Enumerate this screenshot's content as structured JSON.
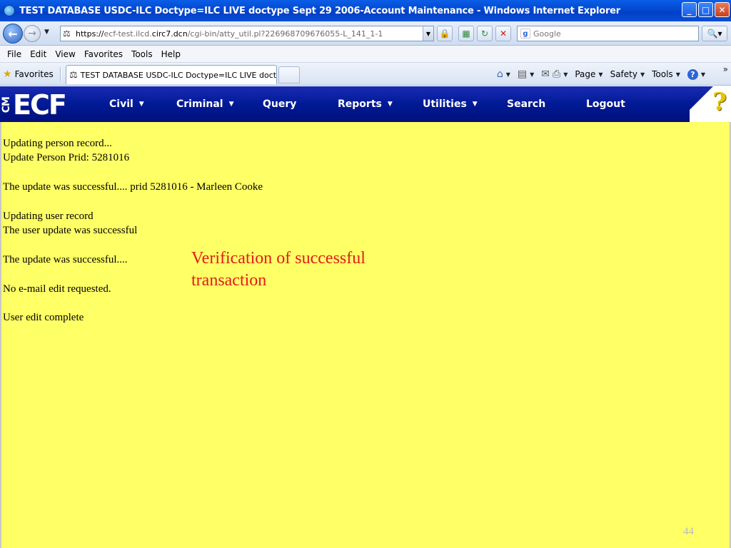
{
  "window": {
    "title": "TEST DATABASE USDC-ILC Doctype=ILC LIVE doctype Sept 29 2006-Account Maintenance - Windows Internet Explorer",
    "buttons": {
      "minimize": "_",
      "maximize": "□",
      "close": "✕"
    }
  },
  "address_bar": {
    "url_prefix": "https://",
    "url_host_dim": "ecf-test.ilcd.",
    "url_host": "circ7.dcn",
    "url_path": "/cgi-bin/atty_util.pl?226968709676055-L_141_1-1",
    "search_placeholder": "Google"
  },
  "menu": {
    "items": [
      "File",
      "Edit",
      "View",
      "Favorites",
      "Tools",
      "Help"
    ]
  },
  "favorites_bar": {
    "favorites_label": "Favorites",
    "tab_title": "TEST DATABASE USDC-ILC Doctype=ILC LIVE doctyp...",
    "commands": {
      "page": "Page",
      "safety": "Safety",
      "tools": "Tools"
    }
  },
  "ecf": {
    "logo_cm": "CM",
    "logo_word": "ECF",
    "nav": [
      {
        "label": "Civil",
        "dropdown": true
      },
      {
        "label": "Criminal",
        "dropdown": true
      },
      {
        "label": "Query",
        "dropdown": false
      },
      {
        "label": "Reports",
        "dropdown": true
      },
      {
        "label": "Utilities",
        "dropdown": true
      },
      {
        "label": "Search",
        "dropdown": false
      },
      {
        "label": "Logout",
        "dropdown": false
      }
    ],
    "help_glyph": "?"
  },
  "content": {
    "lines": [
      "Updating person record...",
      "Update Person Prid: 5281016",
      "The update was successful.... prid 5281016 - Marleen Cooke",
      "Updating user record",
      "The user update was successful",
      "The update was successful....",
      "No e-mail edit requested.",
      "User edit complete"
    ],
    "annotation": "Verification of successful transaction",
    "page_number": "44"
  },
  "colors": {
    "ecf_header": "#001a96",
    "content_bg": "#ffff66",
    "annotation": "#e31b1b"
  }
}
